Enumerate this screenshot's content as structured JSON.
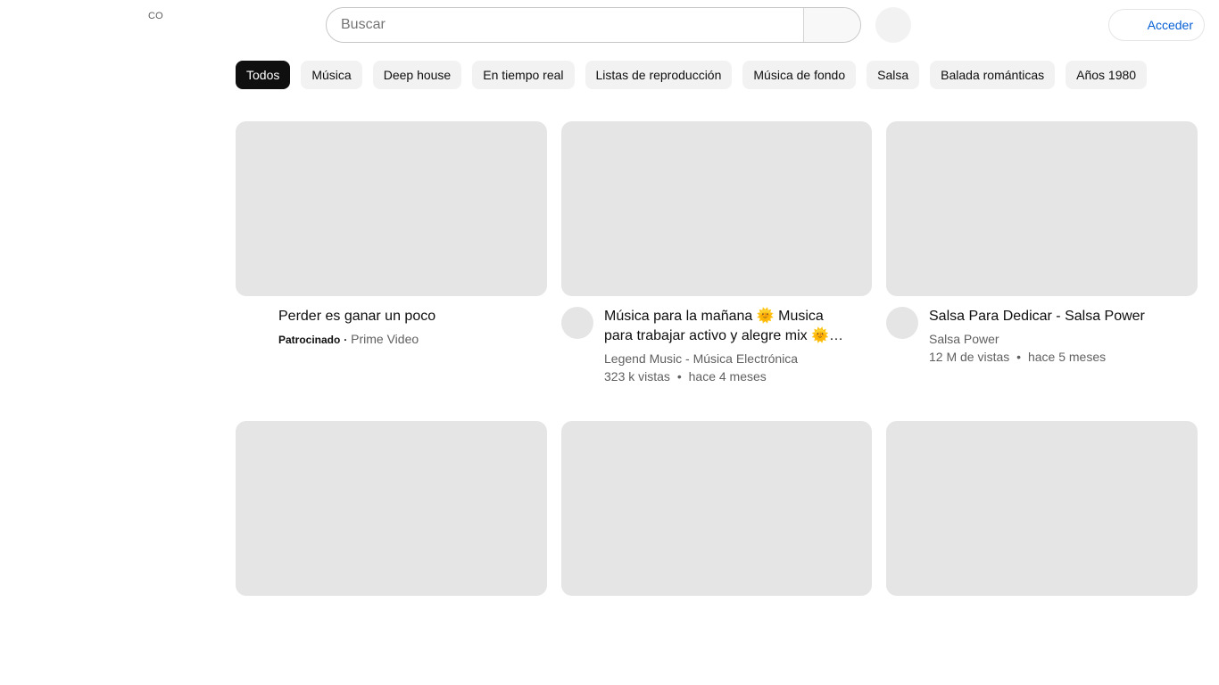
{
  "header": {
    "region_code": "CO",
    "search_placeholder": "Buscar",
    "search_value": "",
    "signin_label": "Acceder"
  },
  "chips": [
    {
      "label": "Todos",
      "active": true
    },
    {
      "label": "Música",
      "active": false
    },
    {
      "label": "Deep house",
      "active": false
    },
    {
      "label": "En tiempo real",
      "active": false
    },
    {
      "label": "Listas de reproducción",
      "active": false
    },
    {
      "label": "Música de fondo",
      "active": false
    },
    {
      "label": "Salsa",
      "active": false
    },
    {
      "label": "Balada románticas",
      "active": false
    },
    {
      "label": "Años 1980",
      "active": false
    }
  ],
  "videos": [
    {
      "title": "Perder es ganar un poco",
      "sponsored_label": "Patrocinado",
      "sponsor_separator": "·",
      "advertiser": "Prime Video"
    },
    {
      "title": "Música para la mañana 🌞 Musica para trabajar activo y alegre mix 🌞 Música Positiva",
      "channel": "Legend Music - Música Electrónica",
      "views": "323 k vistas",
      "separator": "•",
      "age": "hace 4 meses"
    },
    {
      "title": "Salsa Para Dedicar - Salsa Power",
      "channel": "Salsa Power",
      "views": "12 M de vistas",
      "separator": "•",
      "age": "hace 5 meses"
    }
  ],
  "colors": {
    "accent_link": "#065fd4",
    "placeholder_gray": "#e5e5e5",
    "chip_active": "#0f0f0f"
  }
}
